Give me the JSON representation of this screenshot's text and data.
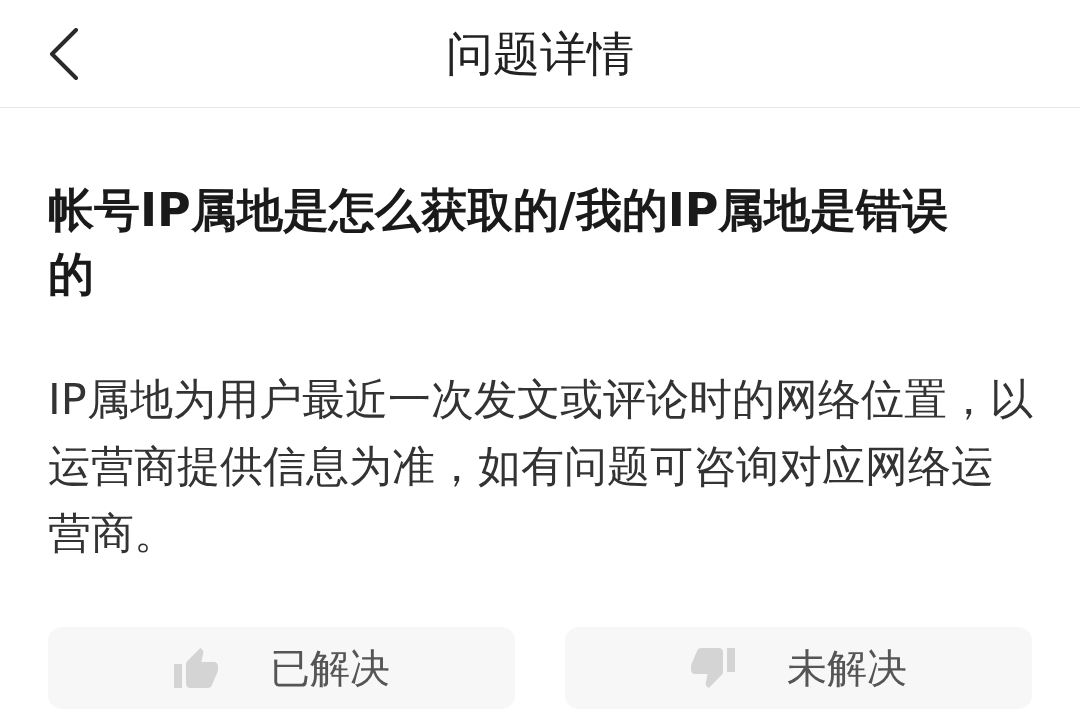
{
  "header": {
    "title": "问题详情"
  },
  "question": {
    "title": "帐号IP属地是怎么获取的/我的IP属地是错误的",
    "answer": "IP属地为用户最近一次发文或评论时的网络位置，以运营商提供信息为准，如有问题可咨询对应网络运营商。"
  },
  "feedback_buttons": [
    {
      "kind": "solved",
      "label": "已解决"
    },
    {
      "kind": "unsolved",
      "label": "未解决"
    }
  ]
}
